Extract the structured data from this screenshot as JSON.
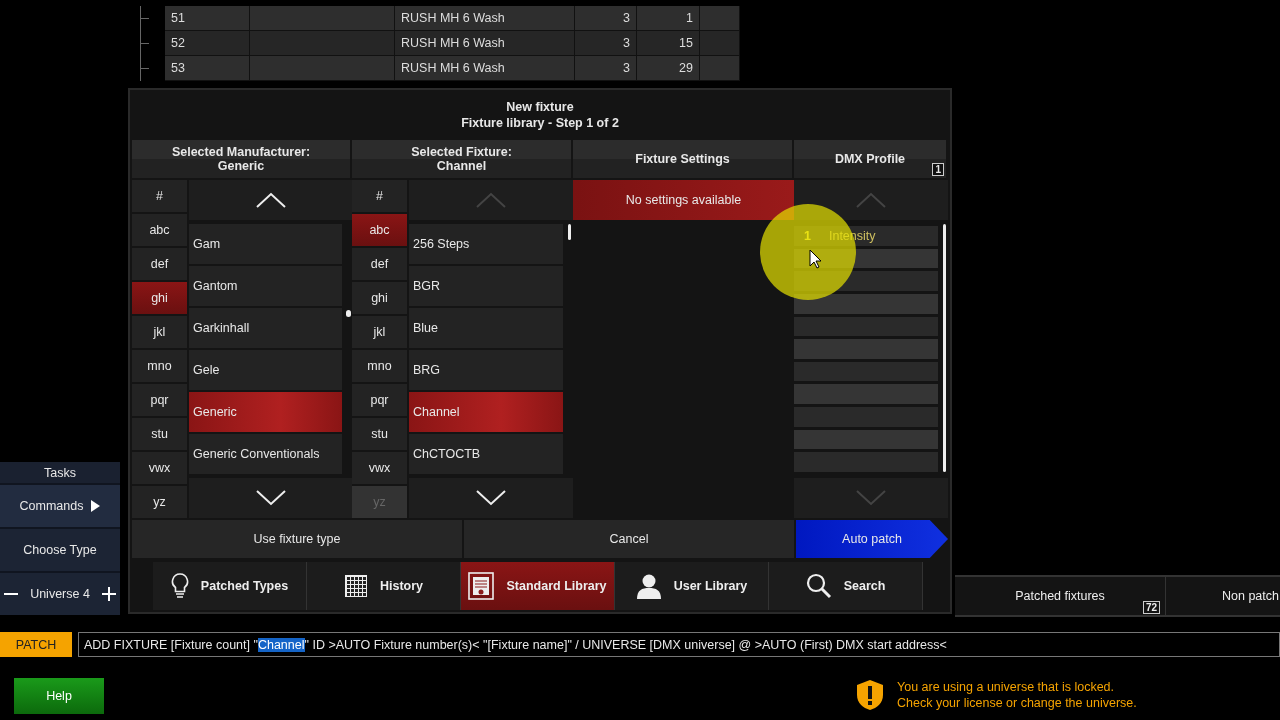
{
  "background_table": {
    "rows": [
      {
        "cells": [
          "51",
          "",
          "RUSH MH 6 Wash",
          "3",
          "1",
          ""
        ]
      },
      {
        "cells": [
          "52",
          "",
          "RUSH MH 6 Wash",
          "3",
          "15",
          ""
        ]
      },
      {
        "cells": [
          "53",
          "",
          "RUSH MH 6 Wash",
          "3",
          "29",
          ""
        ]
      }
    ]
  },
  "tasks_panel": {
    "title": "Tasks",
    "items": [
      {
        "label": "Commands",
        "kind": "submenu"
      },
      {
        "label": "Choose Type",
        "kind": "plain"
      },
      {
        "label": "Universe 4",
        "kind": "stepper"
      }
    ]
  },
  "dialog": {
    "title": "New fixture",
    "subtitle": "Fixture library - Step 1 of 2",
    "manufacturer": {
      "header": "Selected Manufacturer:",
      "value": "Generic",
      "up_disabled": false,
      "down_disabled": false,
      "letters": [
        {
          "label": "#",
          "selected": false,
          "disabled": false
        },
        {
          "label": "abc",
          "selected": false,
          "disabled": false
        },
        {
          "label": "def",
          "selected": false,
          "disabled": false
        },
        {
          "label": "ghi",
          "selected": true,
          "disabled": false
        },
        {
          "label": "jkl",
          "selected": false,
          "disabled": false
        },
        {
          "label": "mno",
          "selected": false,
          "disabled": false
        },
        {
          "label": "pqr",
          "selected": false,
          "disabled": false
        },
        {
          "label": "stu",
          "selected": false,
          "disabled": false
        },
        {
          "label": "vwx",
          "selected": false,
          "disabled": false
        },
        {
          "label": "yz",
          "selected": false,
          "disabled": false
        }
      ],
      "items": [
        {
          "label": "Gam",
          "selected": false
        },
        {
          "label": "Gantom",
          "selected": false
        },
        {
          "label": "Garkinhall",
          "selected": false
        },
        {
          "label": "Gele",
          "selected": false
        },
        {
          "label": "Generic",
          "selected": true
        },
        {
          "label": "Generic Conventionals",
          "selected": false
        }
      ]
    },
    "fixture": {
      "header": "Selected Fixture:",
      "value": "Channel",
      "up_disabled": true,
      "down_disabled": false,
      "letters": [
        {
          "label": "#",
          "selected": false,
          "disabled": false
        },
        {
          "label": "abc",
          "selected": true,
          "disabled": false
        },
        {
          "label": "def",
          "selected": false,
          "disabled": false
        },
        {
          "label": "ghi",
          "selected": false,
          "disabled": false
        },
        {
          "label": "jkl",
          "selected": false,
          "disabled": false
        },
        {
          "label": "mno",
          "selected": false,
          "disabled": false
        },
        {
          "label": "pqr",
          "selected": false,
          "disabled": false
        },
        {
          "label": "stu",
          "selected": false,
          "disabled": false
        },
        {
          "label": "vwx",
          "selected": false,
          "disabled": false
        },
        {
          "label": "yz",
          "selected": false,
          "disabled": true
        }
      ],
      "items": [
        {
          "label": "256 Steps",
          "selected": false
        },
        {
          "label": "BGR",
          "selected": false
        },
        {
          "label": "Blue",
          "selected": false
        },
        {
          "label": "BRG",
          "selected": false
        },
        {
          "label": "Channel",
          "selected": true
        },
        {
          "label": "ChCTOCTB",
          "selected": false
        }
      ]
    },
    "settings": {
      "header": "Fixture Settings",
      "message": "No settings available"
    },
    "dmx_profile": {
      "header": "DMX Profile",
      "badge": "1",
      "up_disabled": true,
      "down_disabled": true,
      "rows": [
        {
          "number": "1",
          "name": "Intensity"
        }
      ]
    },
    "buttons": [
      {
        "label": "Use fixture type",
        "kind": "plain"
      },
      {
        "label": "Cancel",
        "kind": "plain"
      },
      {
        "label": "Auto patch",
        "kind": "primary"
      }
    ],
    "tabs": [
      {
        "label": "Patched Types",
        "selected": false
      },
      {
        "label": "History",
        "selected": false
      },
      {
        "label": "Standard Library",
        "selected": true
      },
      {
        "label": "User Library",
        "selected": false
      },
      {
        "label": "Search",
        "selected": false
      }
    ]
  },
  "fixtures_panel": {
    "tabs": [
      {
        "label": "Patched fixtures",
        "badge": "72"
      },
      {
        "label": "Non patch"
      }
    ]
  },
  "command_line": {
    "mode": "PATCH",
    "text_before": "ADD FIXTURE [Fixture count] \"",
    "selection": "Channel",
    "text_after": "\" ID >AUTO Fixture number(s)< \"[Fixture name]\" / UNIVERSE [DMX universe] @ >AUTO (First) DMX start address<"
  },
  "help_button": "Help",
  "warning": {
    "lines": [
      "You are using a universe that is locked.",
      "Check your license or change the universe."
    ]
  }
}
